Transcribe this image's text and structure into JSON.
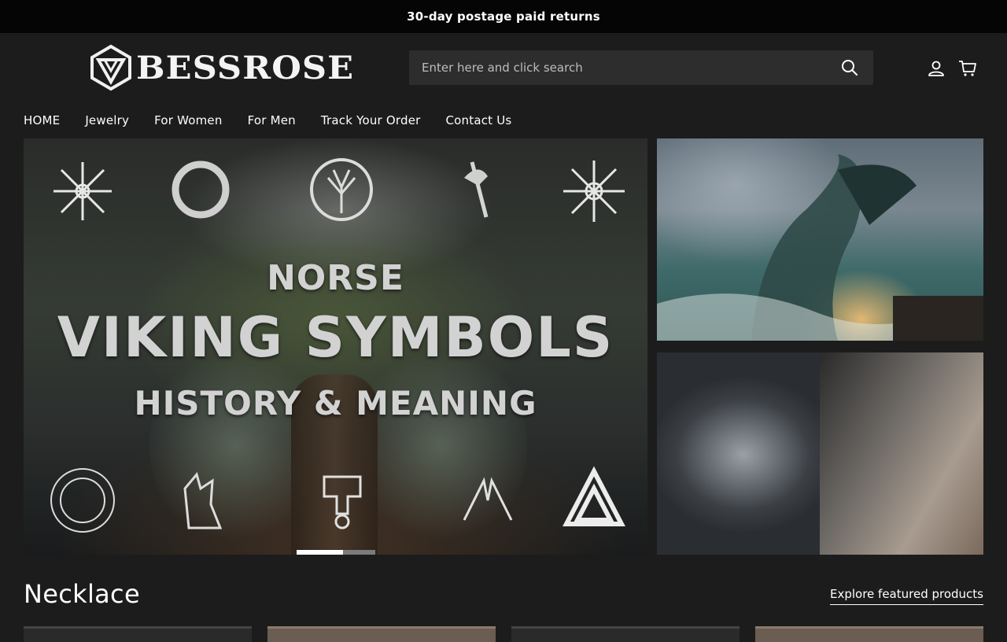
{
  "announcement": {
    "text": "30-day postage paid returns"
  },
  "brand": {
    "name": "BESSROSE"
  },
  "search": {
    "placeholder": "Enter here and click search"
  },
  "nav": {
    "items": [
      {
        "label": "HOME"
      },
      {
        "label": "Jewelry"
      },
      {
        "label": "For Women"
      },
      {
        "label": "For Men"
      },
      {
        "label": "Track Your Order"
      },
      {
        "label": "Contact Us"
      }
    ]
  },
  "hero": {
    "line1": "NORSE",
    "line2": "VIKING SYMBOLS",
    "line3": "HISTORY & MEANING",
    "slides_total": 2,
    "active_slide": 1
  },
  "section": {
    "title": "Necklace",
    "explore_link": "Explore featured products"
  },
  "colors": {
    "background": "#1c1c1c",
    "announcement_bg": "#050505",
    "search_bg": "#2d2d2d",
    "text": "#ffffff"
  }
}
